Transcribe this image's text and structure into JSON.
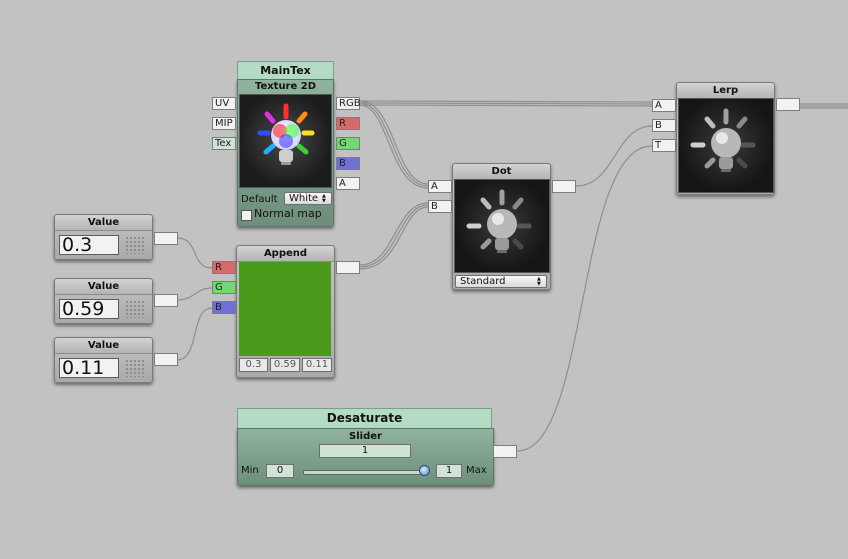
{
  "maintex": {
    "title": "MainTex",
    "subtitle": "Texture 2D",
    "inputs": [
      "UV",
      "MIP",
      "Tex"
    ],
    "outputs": [
      "RGB",
      "R",
      "G",
      "B",
      "A"
    ],
    "default_label": "Default",
    "default_value": "White",
    "normal_map_label": "Normal map",
    "normal_map_checked": false
  },
  "values": [
    {
      "title": "Value",
      "value": "0.3"
    },
    {
      "title": "Value",
      "value": "0.59"
    },
    {
      "title": "Value",
      "value": "0.11"
    }
  ],
  "append": {
    "title": "Append",
    "inputs": [
      "R",
      "G",
      "B"
    ],
    "preview_color": "#4a9a1c",
    "components": [
      "0.3",
      "0.59",
      "0.11"
    ]
  },
  "dot": {
    "title": "Dot",
    "inputs": [
      "A",
      "B"
    ],
    "mode": "Standard"
  },
  "lerp": {
    "title": "Lerp",
    "inputs": [
      "A",
      "B",
      "T"
    ]
  },
  "desaturate": {
    "title": "Desaturate",
    "subtitle": "Slider",
    "value": "1",
    "min_label": "Min",
    "min_value": "0",
    "max_value": "1",
    "max_label": "Max",
    "slider_fraction": 1.0
  },
  "colors": {
    "canvas": "#c2c2c2",
    "wire": "#8a8a8a",
    "port_r": "#d46a6a",
    "port_g": "#72d872",
    "port_b": "#6f6fd4",
    "property_green": "#b4dcc4"
  }
}
